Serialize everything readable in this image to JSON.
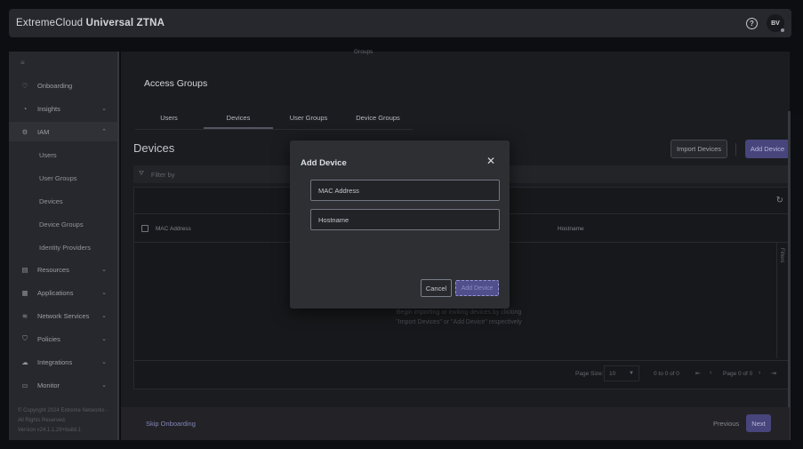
{
  "app": {
    "brand_prefix": "ExtremeCloud",
    "brand_suffix": "Universal ZTNA",
    "help_icon": "?",
    "avatar_initials": "BV"
  },
  "sidebar": {
    "toggle_icon": "≡",
    "items": [
      {
        "label": "Onboarding",
        "icon": "heart-icon",
        "glyph": "♡",
        "chevron": ""
      },
      {
        "label": "Insights",
        "icon": "gauge-icon",
        "glyph": "◔",
        "chevron": "⌄"
      },
      {
        "label": "IAM",
        "icon": "gear-icon",
        "glyph": "⚙",
        "chevron": "⌃"
      },
      {
        "label": "Resources",
        "icon": "resources-icon",
        "glyph": "▤",
        "chevron": "⌄"
      },
      {
        "label": "Applications",
        "icon": "grid-icon",
        "glyph": "▦",
        "chevron": "⌄"
      },
      {
        "label": "Network Services",
        "icon": "wifi-icon",
        "glyph": "≋",
        "chevron": "⌄"
      },
      {
        "label": "Policies",
        "icon": "shield-icon",
        "glyph": "⛉",
        "chevron": "⌄"
      },
      {
        "label": "Integrations",
        "icon": "cloud-icon",
        "glyph": "☁",
        "chevron": "⌄"
      },
      {
        "label": "Monitor",
        "icon": "monitor-icon",
        "glyph": "▭",
        "chevron": "⌄"
      }
    ],
    "sub_items": [
      "Users",
      "User Groups",
      "Devices",
      "Device Groups",
      "Identity Providers"
    ],
    "footer": {
      "copyright": "© Copyright 2024 Extreme Networks -",
      "rights": "All Rights Reserved.",
      "version": "Version v24.1.1.29+build.1"
    }
  },
  "main": {
    "groups_cut": "Groups",
    "section_title": "Access Groups",
    "tabs": [
      "Users",
      "Devices",
      "User Groups",
      "Device Groups"
    ],
    "active_tab": "Devices",
    "page_title": "Devices",
    "import_button": "Import Devices",
    "add_button": "Add Device",
    "filter_placeholder": "Filter by",
    "columns": [
      "MAC Address",
      "Hostname"
    ],
    "filters_label": "Filters",
    "empty_line1": "Begin importing or inviting devices by clicking",
    "empty_line2": "\"Import Devices\" or \"Add Device\" respectively",
    "pagination": {
      "page_size_label": "Page Size:",
      "page_size": "10",
      "range": "0 to 0 of 0",
      "page_label": "Page 0 of 0"
    }
  },
  "bottom": {
    "skip": "Skip Onboarding",
    "previous": "Previous",
    "next": "Next"
  },
  "modal": {
    "title": "Add Device",
    "close_icon": "✕",
    "mac_placeholder": "MAC Address",
    "host_placeholder": "Hostname",
    "cancel": "Cancel",
    "add": "Add Device"
  },
  "colors": {
    "accent": "#4e4b87",
    "background": "#0f1013",
    "panel": "#2a2c31"
  }
}
